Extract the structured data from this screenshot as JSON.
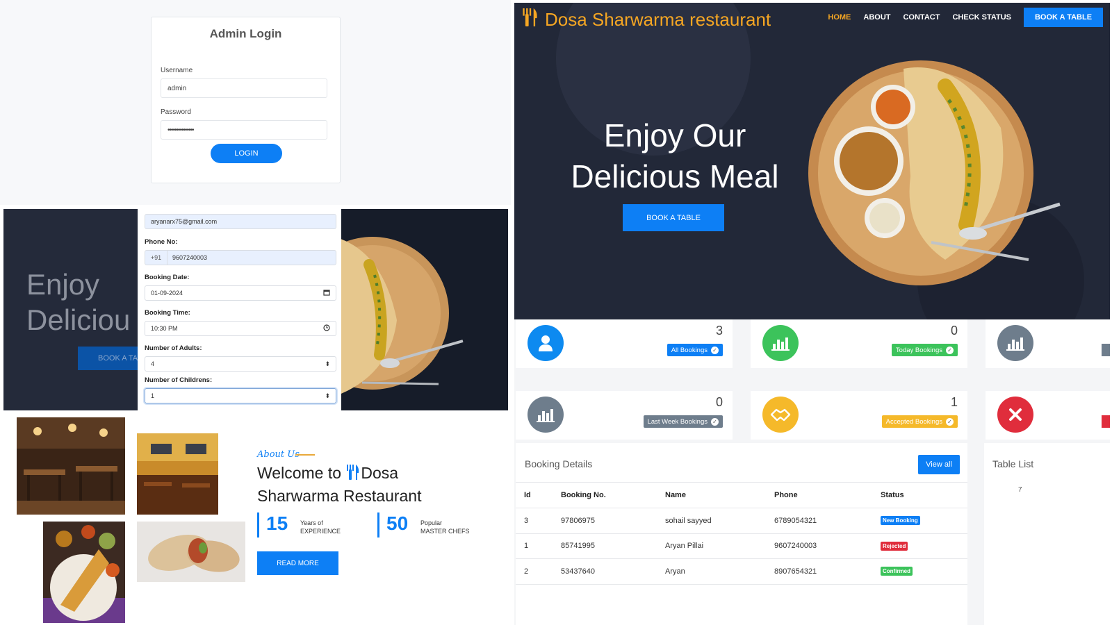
{
  "login": {
    "title": "Admin Login",
    "username_label": "Username",
    "username_value": "admin",
    "password_label": "Password",
    "password_value": "•••••••••••••••",
    "button": "LOGIN"
  },
  "form_bg": {
    "enjoy_line1": "Enjoy",
    "enjoy_line2": "Deliciou",
    "button_partial": "BOOK A TA"
  },
  "booking_form": {
    "email_value": "aryanarx75@gmail.com",
    "phone_label": "Phone No:",
    "phone_prefix": "+91",
    "phone_value": "9607240003",
    "date_label": "Booking Date:",
    "date_value": "01-09-2024",
    "time_label": "Booking Time:",
    "time_value": "10:30 PM",
    "adults_label": "Number of Adults:",
    "adults_value": "4",
    "children_label": "Number of Childrens:",
    "children_value": "1"
  },
  "about": {
    "subtitle": "About Us",
    "title_part1": "Welcome to",
    "title_part2": "Dosa",
    "title_line2": "Sharwarma Restaurant",
    "stat1_number": "15",
    "stat1_line1": "Years of",
    "stat1_line2": "EXPERIENCE",
    "stat2_number": "50",
    "stat2_line1": "Popular",
    "stat2_line2": "MASTER CHEFS",
    "button": "READ MORE"
  },
  "hero": {
    "brand": "Dosa Sharwarma restaurant",
    "nav": [
      "HOME",
      "ABOUT",
      "CONTACT",
      "CHECK STATUS"
    ],
    "nav_book": "BOOK A TABLE",
    "headline_line1": "Enjoy Our",
    "headline_line2": "Delicious Meal",
    "button": "BOOK A TABLE"
  },
  "stats": {
    "all_bookings": {
      "count": "3",
      "label": "All Bookings"
    },
    "today_bookings": {
      "count": "0",
      "label": "Today Bookings"
    },
    "last_week_bookings": {
      "count": "0",
      "label": "Last Week Bookings"
    },
    "accepted_bookings": {
      "count": "1",
      "label": "Accepted Bookings"
    }
  },
  "booking_details": {
    "title": "Booking Details",
    "view_all": "View all",
    "headers": [
      "Id",
      "Booking No.",
      "Name",
      "Phone",
      "Status"
    ],
    "rows": [
      {
        "id": "3",
        "booking_no": "97806975",
        "name": "sohail sayyed",
        "phone": "6789054321",
        "status": "New Booking"
      },
      {
        "id": "1",
        "booking_no": "85741995",
        "name": "Aryan Pillai",
        "phone": "9607240003",
        "status": "Rejected"
      },
      {
        "id": "2",
        "booking_no": "53437640",
        "name": "Aryan",
        "phone": "8907654321",
        "status": "Confirmed"
      }
    ]
  },
  "table_list": {
    "title": "Table List",
    "value": "7"
  },
  "colors": {
    "primary": "#0d7ff5",
    "brand_orange": "#f5a623",
    "success": "#3cc35b",
    "danger": "#e02d3c",
    "secondary": "#6e7d8c",
    "warning": "#f5b92a",
    "hero_bg": "#23293a"
  },
  "icons": [
    "utensils-icon",
    "user-icon",
    "bar-chart-icon",
    "handshake-icon",
    "close-icon",
    "calendar-icon",
    "clock-icon",
    "select-arrows-icon",
    "check-circle-icon"
  ]
}
